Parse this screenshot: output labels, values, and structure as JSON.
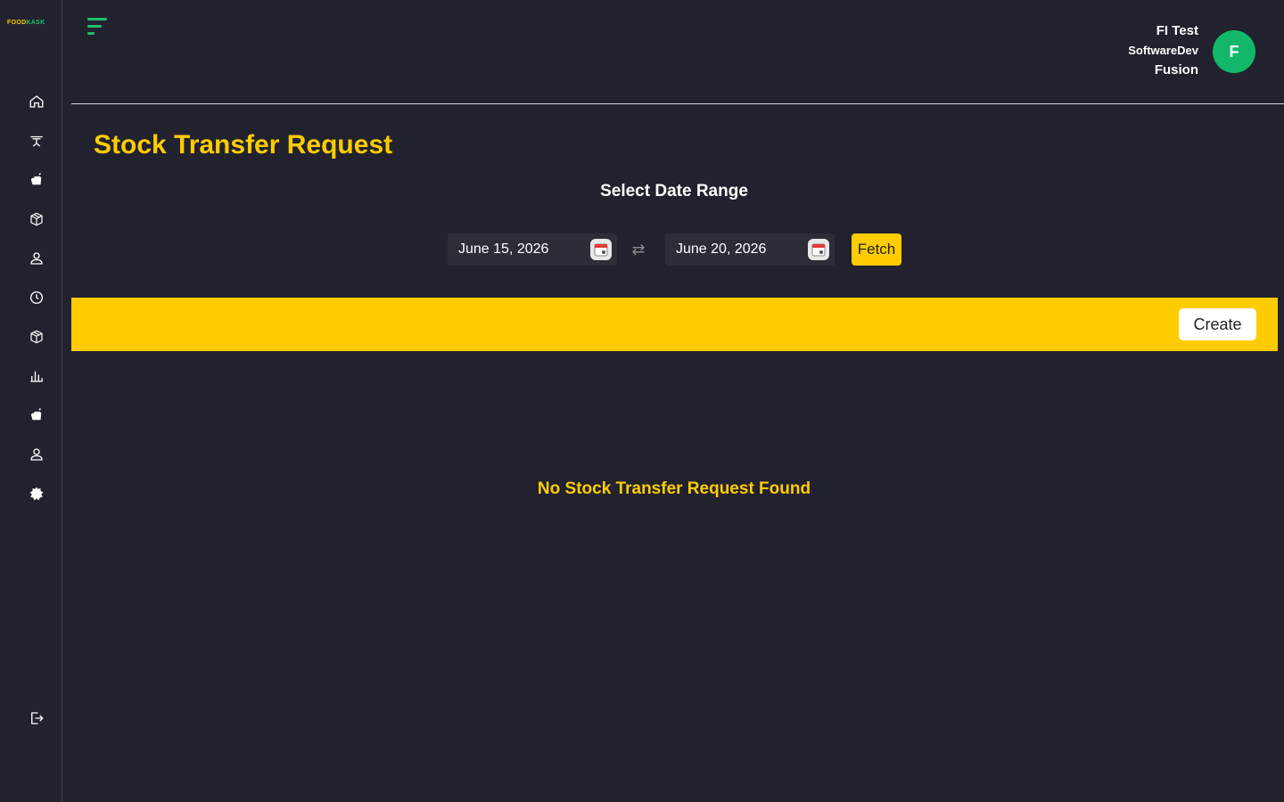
{
  "app": {
    "logo_part1": "FOOD",
    "logo_part2": "KASK"
  },
  "sidebar": {
    "items": [
      {
        "icon": "home-icon"
      },
      {
        "icon": "dining-table-icon"
      },
      {
        "icon": "chef-hat-icon"
      },
      {
        "icon": "box-icon"
      },
      {
        "icon": "user-icon"
      },
      {
        "icon": "clock-icon"
      },
      {
        "icon": "package-icon"
      },
      {
        "icon": "bar-chart-icon"
      },
      {
        "icon": "chef-hat-filled-icon"
      },
      {
        "icon": "user-profile-icon"
      },
      {
        "icon": "settings-icon"
      }
    ],
    "logout_icon": "logout-icon"
  },
  "header": {
    "user_name": "FI Test",
    "user_department": "SoftwareDev",
    "user_company": "Fusion",
    "avatar_initial": "F"
  },
  "page": {
    "title": "Stock Transfer Request",
    "range_title": "Select Date Range",
    "start_date": "June 15, 2026",
    "end_date": "June 20, 2026",
    "fetch_label": "Fetch",
    "create_label": "Create",
    "empty_message": "No Stock Transfer Request Found"
  },
  "colors": {
    "background": "#22222e",
    "accent": "#ffcc00",
    "brand_green": "#1fbf6b"
  }
}
